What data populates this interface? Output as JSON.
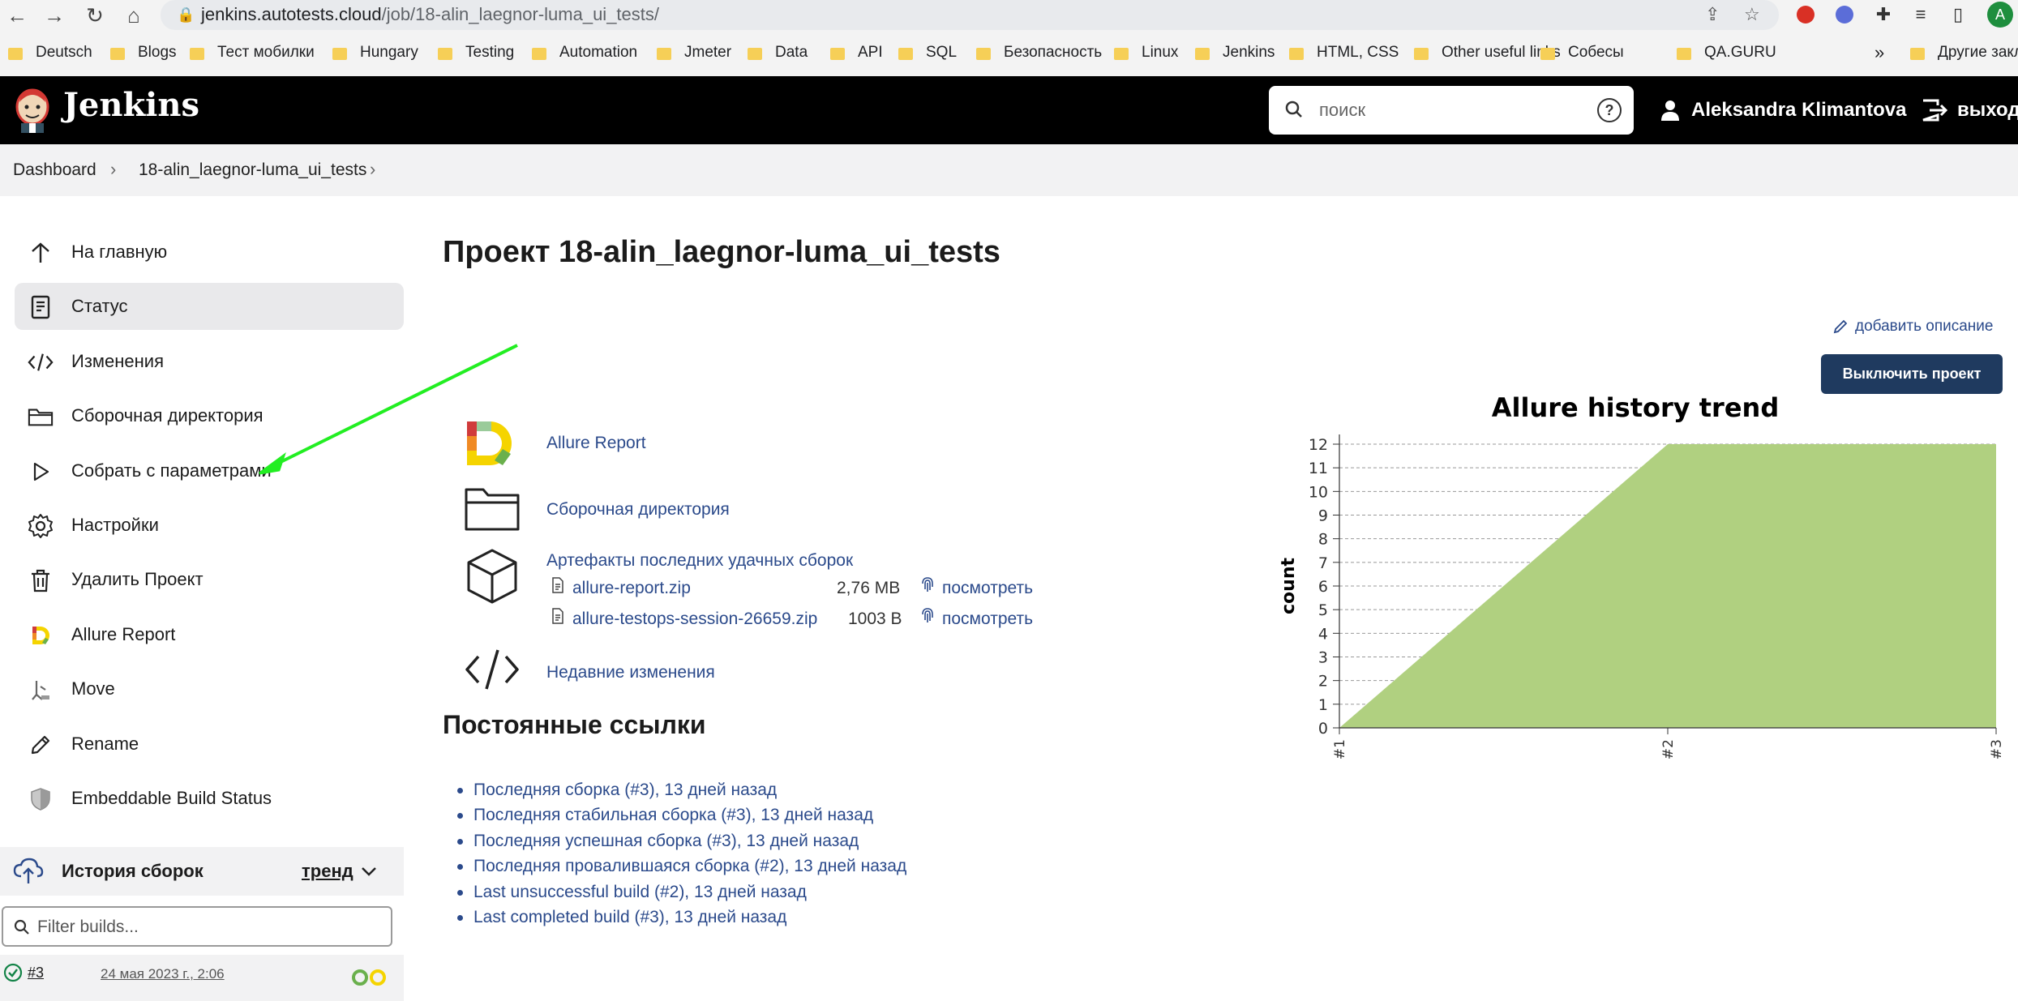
{
  "browser": {
    "url_host": "jenkins.autotests.cloud",
    "url_path": "/job/18-alin_laegnor-luma_ui_tests/",
    "profile_initial": "A",
    "bookmarks": [
      "Deutsch",
      "Blogs",
      "Тест мобилки",
      "Hungary",
      "Testing",
      "Automation",
      "Jmeter",
      "Data",
      "API",
      "SQL",
      "Безопасность",
      "Linux",
      "Jenkins",
      "HTML, CSS",
      "Other useful links",
      "Собесы",
      "QA.GURU"
    ],
    "bookmarks_more": "»",
    "other_bookmarks": "Другие закл"
  },
  "header": {
    "title": "Jenkins",
    "search_placeholder": "поиск",
    "help": "?",
    "user_name": "Aleksandra Klimantova",
    "logout_label": "выход"
  },
  "breadcrumb": {
    "items": [
      "Dashboard",
      "18-alin_laegnor-luma_ui_tests"
    ]
  },
  "sidebar": {
    "items": [
      {
        "label": "На главную",
        "icon": "arrow-up-icon"
      },
      {
        "label": "Статус",
        "icon": "document-icon",
        "active": true
      },
      {
        "label": "Изменения",
        "icon": "code-icon"
      },
      {
        "label": "Сборочная директория",
        "icon": "folder-icon"
      },
      {
        "label": "Собрать с параметрами",
        "icon": "play-icon"
      },
      {
        "label": "Настройки",
        "icon": "gear-icon"
      },
      {
        "label": "Удалить Проект",
        "icon": "trash-icon"
      },
      {
        "label": "Allure Report",
        "icon": "allure-icon"
      },
      {
        "label": "Move",
        "icon": "move-icon"
      },
      {
        "label": "Rename",
        "icon": "pencil-icon"
      },
      {
        "label": "Embeddable Build Status",
        "icon": "shield-icon"
      }
    ],
    "history": {
      "title": "История сборок",
      "trend_label": "тренд",
      "filter_placeholder": "Filter builds...",
      "build_number": "#3",
      "build_date": "24 мая 2023 г., 2:06"
    }
  },
  "main": {
    "title": "Проект 18-alin_laegnor-luma_ui_tests",
    "add_description": "добавить описание",
    "disable_button": "Выключить проект",
    "allure_report": "Allure Report",
    "workspace": "Сборочная директория",
    "artifacts_title": "Артефакты последних удачных сборок",
    "artifacts": [
      {
        "name": "allure-report.zip",
        "size": "2,76 MB",
        "view": "посмотреть"
      },
      {
        "name": "allure-testops-session-26659.zip",
        "size": "1003 B",
        "view": "посмотреть"
      }
    ],
    "recent_changes": "Недавние изменения",
    "permalinks_title": "Постоянные ссылки",
    "permalinks": [
      "Последняя сборка (#3), 13 дней назад",
      "Последняя стабильная сборка (#3), 13 дней назад",
      "Последняя успешная сборка (#3), 13 дней назад",
      "Последняя провалившаяся сборка (#2), 13 дней назад",
      "Last unsuccessful build (#2), 13 дней назад",
      "Last completed build (#3), 13 дней назад"
    ]
  },
  "colors": {
    "header_bg": "#000000",
    "link": "#2b4a8b",
    "button_bg": "#1f3a5f",
    "chart_fill": "#b0d080",
    "annotation_arrow": "#22ee22"
  },
  "chart_data": {
    "type": "area",
    "title": "Allure history trend",
    "ylabel": "count",
    "categories": [
      "#1",
      "#2",
      "#3"
    ],
    "series": [
      {
        "values": [
          0,
          12,
          12
        ]
      }
    ],
    "ylim": [
      0,
      12
    ],
    "yticks": [
      0,
      1,
      2,
      3,
      4,
      5,
      6,
      7,
      8,
      9,
      10,
      11,
      12
    ],
    "grid": true
  }
}
